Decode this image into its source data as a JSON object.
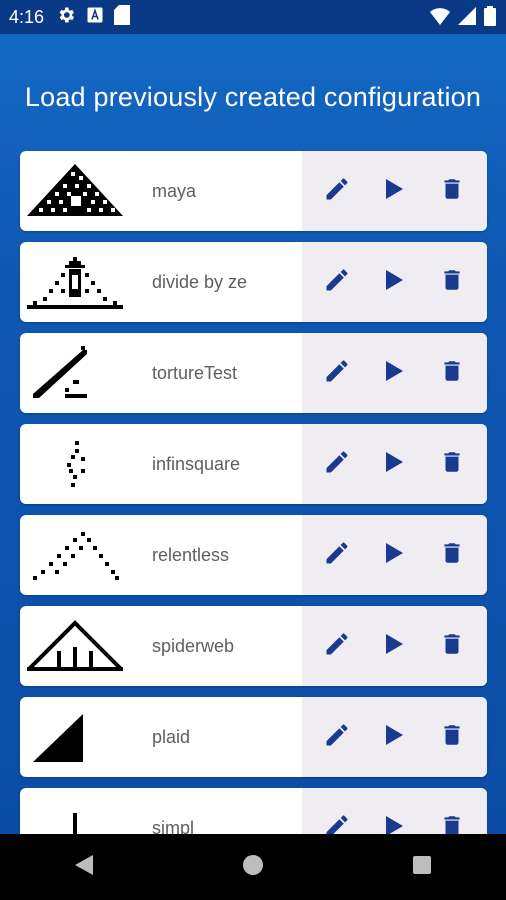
{
  "status_bar": {
    "time": "4:16",
    "left_icons": [
      "settings-icon",
      "font-a-icon",
      "sd-card-icon"
    ],
    "right_icons": [
      "wifi-icon",
      "cellular-icon",
      "battery-icon"
    ]
  },
  "header": {
    "title": "Load previously created configuration"
  },
  "configurations": [
    {
      "name": "maya"
    },
    {
      "name": "divide by ze"
    },
    {
      "name": "tortureTest"
    },
    {
      "name": "infinsquare"
    },
    {
      "name": "relentless"
    },
    {
      "name": "spiderweb"
    },
    {
      "name": "plaid"
    },
    {
      "name": "simpl"
    }
  ],
  "row_actions": [
    "edit-icon",
    "play-icon",
    "delete-icon"
  ],
  "nav_bar": [
    "back-icon",
    "home-icon",
    "recents-icon"
  ],
  "colors": {
    "accent": "#1a3a8f",
    "action_panel": "#efedf1",
    "status_bar": "#0a3a86"
  }
}
